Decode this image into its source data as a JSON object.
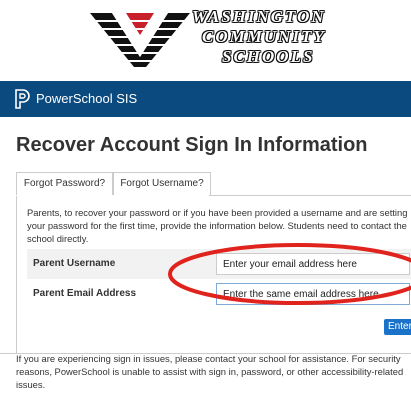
{
  "logo": {
    "line1": "WASHINGTON",
    "line2": "COMMUNITY",
    "line3": "SCHOOLS"
  },
  "header": {
    "app_title": "PowerSchool SIS"
  },
  "page": {
    "title": "Recover Account Sign In Information"
  },
  "tabs": [
    {
      "label": "Forgot Password?",
      "active": true
    },
    {
      "label": "Forgot Username?",
      "active": false
    }
  ],
  "form": {
    "intro": "Parents, to recover your password or if you have been provided a username and are setting your password for the first time, provide the information below. Students need to contact the school directly.",
    "fields": [
      {
        "label": "Parent Username",
        "value": "Enter your email address here"
      },
      {
        "label": "Parent Email Address",
        "value": "Enter the same email address here"
      }
    ],
    "submit_label": "Enter"
  },
  "help": {
    "text": "If you are experiencing sign in issues, please contact your school for assistance. For security reasons, PowerSchool is unable to assist with sign in, password, or other accessibility-related issues."
  },
  "colors": {
    "header_bar": "#0a4a7f",
    "button": "#1a73c9",
    "annotation": "#e0231c",
    "logo_red": "#c8202a"
  },
  "icons": {
    "district_logo": "w-chevron-logo",
    "brand": "powerschool-p-icon"
  }
}
